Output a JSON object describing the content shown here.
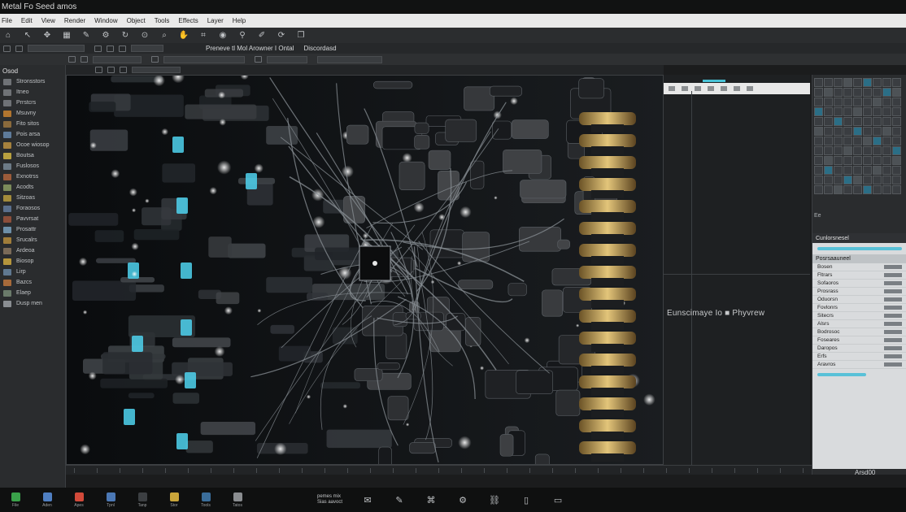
{
  "window": {
    "title": "Metal Fo Seed amos"
  },
  "menubar": {
    "items": [
      "File",
      "Edit",
      "View",
      "Render",
      "Window",
      "Object",
      "Tools",
      "Effects",
      "Layer",
      "Help"
    ]
  },
  "toolbar": {
    "icons": [
      "home-icon",
      "select-icon",
      "move-icon",
      "grid-icon",
      "brush-icon",
      "settings-icon",
      "rotate-icon",
      "zoom-icon",
      "search-icon",
      "pan-icon",
      "crop-icon",
      "camera-icon",
      "pin-icon",
      "edit-icon",
      "refresh-icon",
      "layers-icon"
    ],
    "center_label": "Preneve tl Mol Arowner I Ontal",
    "right_label": "Discordasd"
  },
  "left_panel": {
    "header": "Osod",
    "items": [
      {
        "label": "Stronsstors",
        "color": "#6f7276"
      },
      {
        "label": "Itneo",
        "color": "#6f7276"
      },
      {
        "label": "Prrstcrs",
        "color": "#6f7276"
      },
      {
        "label": "Msuvny",
        "color": "#b1752f"
      },
      {
        "label": "Fito sitos",
        "color": "#8a6a3c"
      },
      {
        "label": "Pois arsa",
        "color": "#5e7b9a"
      },
      {
        "label": "Ocoe wiosop",
        "color": "#a5813d"
      },
      {
        "label": "Boutsa",
        "color": "#b8a03f"
      },
      {
        "label": "Fuslosos",
        "color": "#6c7a86"
      },
      {
        "label": "Exnotrss",
        "color": "#9b5b3a"
      },
      {
        "label": "Acodts",
        "color": "#7b8b5a"
      },
      {
        "label": "Sitzoas",
        "color": "#a38b3b"
      },
      {
        "label": "Foraosos",
        "color": "#5a6f8c"
      },
      {
        "label": "Pavvrsat",
        "color": "#8c4e3a"
      },
      {
        "label": "Prosattr",
        "color": "#6d8fa8"
      },
      {
        "label": "Srucalrs",
        "color": "#a07d3a"
      },
      {
        "label": "Ardeoa",
        "color": "#7a6a58"
      },
      {
        "label": "Biosop",
        "color": "#b5953c"
      },
      {
        "label": "Lirp",
        "color": "#5f7890"
      },
      {
        "label": "Bazcs",
        "color": "#a76a3a"
      },
      {
        "label": "Elaep",
        "color": "#6a7a6a"
      },
      {
        "label": "Dusp men",
        "color": "#8a8e92"
      }
    ]
  },
  "preview": {
    "label": "Eunscimaye Io  ■  Phyvrew",
    "accent_color": "#49c2d6"
  },
  "right_panel": {
    "status": "Ee",
    "section_title": "Cunlorsnesel",
    "sub_title": "Posrsaauneel",
    "rows": [
      "Bosen",
      "Fltrars",
      "Sofaoros",
      "Prosrass",
      "Oduorsn",
      "Fovlonrs",
      "Sitecrs",
      "Alsrs",
      "Bodrosoc",
      "Foseares",
      "Daropos",
      "Erfs",
      "Aravros"
    ],
    "footer": "Arsd00"
  },
  "taskbar": {
    "items": [
      {
        "label": "File",
        "color": "#3aa14a"
      },
      {
        "label": "Aden",
        "color": "#4f7fc2"
      },
      {
        "label": "Apes",
        "color": "#d24a3a"
      },
      {
        "label": "Tpnl",
        "color": "#4b78b5"
      },
      {
        "label": "Tanp",
        "color": "#3c3f42"
      },
      {
        "label": "Stor",
        "color": "#c9a53a"
      },
      {
        "label": "Tools",
        "color": "#3a6d9a"
      },
      {
        "label": "Tatos",
        "color": "#8a8d90"
      }
    ],
    "status_line1": "pemes mix",
    "status_line2": "Sias aavoct",
    "tray_icons": [
      "chat-icon",
      "edit-icon",
      "tag-icon",
      "settings-icon",
      "link-icon",
      "phone-icon",
      "monitor-icon"
    ]
  }
}
